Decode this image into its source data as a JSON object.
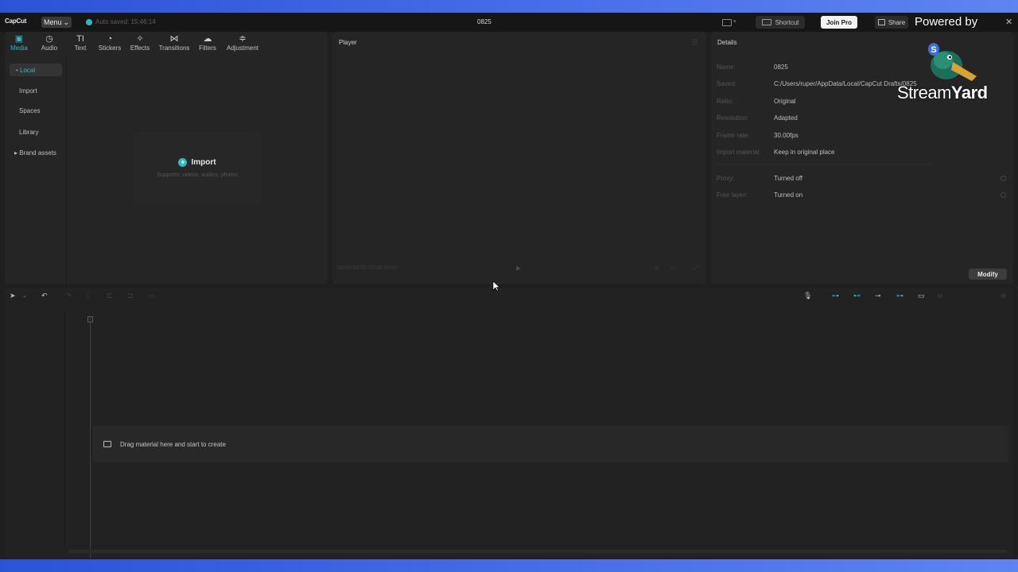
{
  "titlebar": {
    "logo": "CapCut",
    "menu_label": "Menu",
    "autosave_text": "Auto saved: 15:46:14",
    "project_title": "0825",
    "shortcut_label": "Shortcut",
    "join_pro_label": "Join Pro",
    "share_label": "Share",
    "close_glyph": "✕"
  },
  "overlay": {
    "powered_by": "Powered by",
    "brand_light": "Stream",
    "brand_bold": "Yard"
  },
  "media": {
    "tools": [
      {
        "label": "Media",
        "icon": "▣"
      },
      {
        "label": "Audio",
        "icon": "◷"
      },
      {
        "label": "Text",
        "icon": "TI"
      },
      {
        "label": "Stickers",
        "icon": "◔"
      },
      {
        "label": "Effects",
        "icon": "✧"
      },
      {
        "label": "Transitions",
        "icon": "⋈"
      },
      {
        "label": "Filters",
        "icon": "☁"
      },
      {
        "label": "Adjustment",
        "icon": "≑"
      }
    ],
    "sidebar": [
      "• Local",
      "Import",
      "Spaces",
      "Library",
      "▸ Brand assets"
    ],
    "import_label": "Import",
    "import_sub": "Supports: videos, audios, photos"
  },
  "player": {
    "title": "Player",
    "time": "00:00:00:00  00:00:00:00"
  },
  "details": {
    "title": "Details",
    "rows": [
      {
        "label": "Name:",
        "value": "0825"
      },
      {
        "label": "Saved:",
        "value": "C:/Users/ruper/AppData/Local/CapCut Drafts/0825"
      },
      {
        "label": "Ratio:",
        "value": "Original"
      },
      {
        "label": "Resolution:",
        "value": "Adapted"
      },
      {
        "label": "Frame rate:",
        "value": "30.00fps"
      },
      {
        "label": "Import material:",
        "value": "Keep in original place"
      },
      {
        "label": "Proxy:",
        "value": "Turned off"
      },
      {
        "label": "Free layer:",
        "value": "Turned on"
      }
    ],
    "modify_label": "Modify"
  },
  "timeline": {
    "hint": "Drag material here and start to create"
  },
  "colors": {
    "accent": "#2fb7c3",
    "background": "#1f1f1f",
    "panel": "#252525"
  }
}
